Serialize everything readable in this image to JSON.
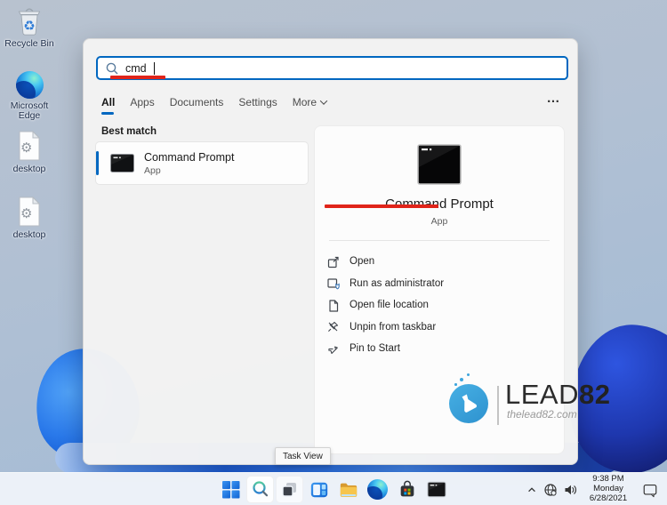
{
  "colors": {
    "accent": "#0067c0",
    "annotation_red": "#e0241a"
  },
  "desktop_icons": [
    {
      "label": "Recycle Bin",
      "icon": "recycle-bin-icon"
    },
    {
      "label": "Microsoft Edge",
      "icon": "microsoft-edge-icon"
    },
    {
      "label": "desktop",
      "icon": "config-file-icon"
    },
    {
      "label": "desktop",
      "icon": "config-file-icon"
    }
  ],
  "search_panel": {
    "search_value": "cmd",
    "tabs": [
      {
        "label": "All"
      },
      {
        "label": "Apps"
      },
      {
        "label": "Documents"
      },
      {
        "label": "Settings"
      },
      {
        "label": "More"
      }
    ],
    "more_button": "…",
    "best_match_header": "Best match",
    "best_match": {
      "title": "Command Prompt",
      "subtitle": "App"
    },
    "detail": {
      "title": "Command Prompt",
      "subtitle": "App",
      "actions": [
        {
          "label": "Open"
        },
        {
          "label": "Run as administrator"
        },
        {
          "label": "Open file location"
        },
        {
          "label": "Unpin from taskbar"
        },
        {
          "label": "Pin to Start"
        }
      ]
    }
  },
  "watermark": {
    "brand_thin": "LEAD",
    "brand_bold": "82",
    "website": "thelead82.com"
  },
  "taskbar": {
    "tooltip": "Task View",
    "tray": {
      "time": "9:38 PM",
      "day": "Monday",
      "date": "6/28/2021"
    }
  }
}
